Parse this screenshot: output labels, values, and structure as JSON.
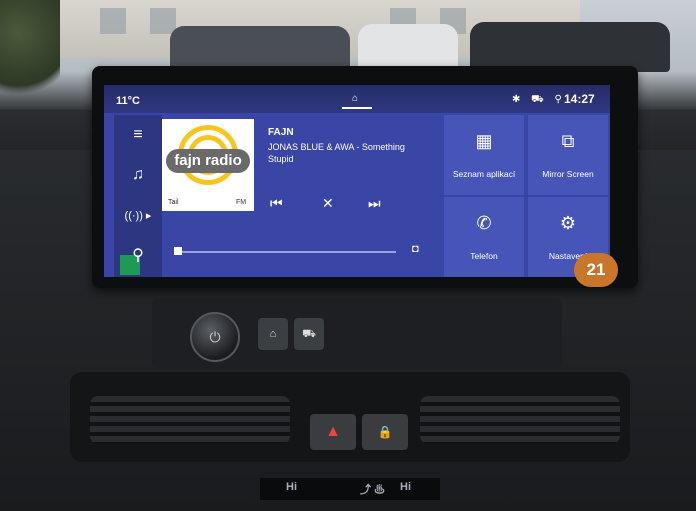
{
  "status_bar": {
    "temperature": "11°C",
    "time": "14:27",
    "home_icon": "home-icon",
    "status_icons": "✱ ⛟ ⚲"
  },
  "sidebar": {
    "items": [
      {
        "icon": "menu-icon",
        "glyph": "≡"
      },
      {
        "icon": "music-icon",
        "glyph": "♫"
      },
      {
        "icon": "radio-icon",
        "glyph": "((·)) ▸"
      },
      {
        "icon": "search-icon",
        "glyph": "⚲"
      }
    ]
  },
  "media": {
    "station": "FAJN",
    "track": "JONAS BLUE & AWA - Something Stupid",
    "album_art_text": "fajn radio",
    "art_signal": "Tail",
    "art_band": "FM",
    "prev_glyph": "⏮",
    "mute_glyph": "✕",
    "next_glyph": "⏭",
    "source_glyph": "◘"
  },
  "tiles": [
    {
      "label": "Seznam aplikací",
      "icon": "apps-grid-icon",
      "glyph": "▦"
    },
    {
      "label": "Mirror Screen",
      "icon": "mirror-screen-icon",
      "glyph": "⧉"
    },
    {
      "label": "Telefon",
      "icon": "phone-icon",
      "glyph": "✆"
    },
    {
      "label": "Nastavení",
      "icon": "settings-gear-icon",
      "glyph": "⚙"
    }
  ],
  "overlay_badge": "21",
  "hardware": {
    "power_glyph": "⏻",
    "home_glyph": "⌂",
    "car_glyph": "⛟",
    "hazard_glyph": "▲",
    "lock_glyph": "🔒"
  },
  "climate_display": {
    "left": "Hi",
    "mid": "⤴ ♨",
    "right": "Hi"
  }
}
